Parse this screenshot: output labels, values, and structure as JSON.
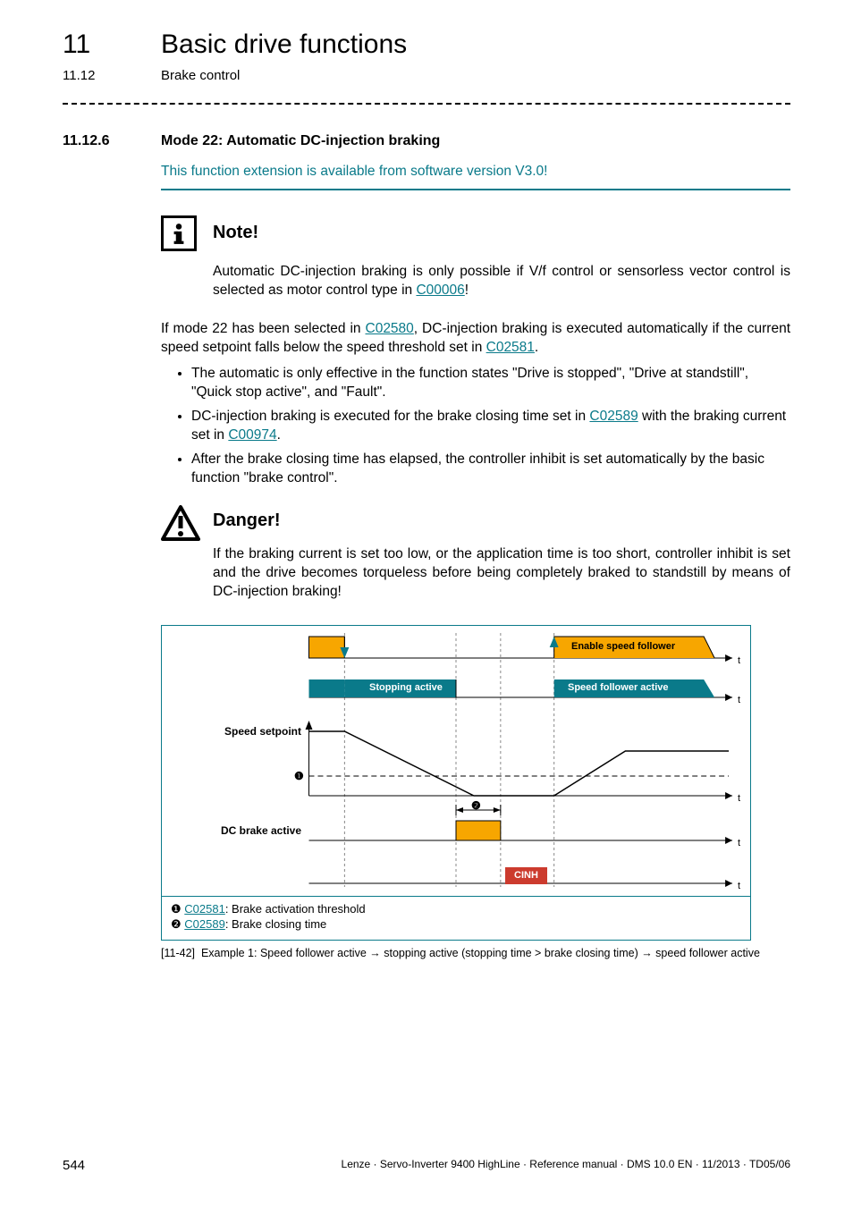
{
  "header": {
    "chapter_num": "11",
    "chapter_title": "Basic drive functions",
    "sub_num": "11.12",
    "sub_title": "Brake control"
  },
  "section": {
    "num": "11.12.6",
    "title": "Mode 22: Automatic DC-injection braking",
    "highlight": "This function extension is available from software version V3.0!"
  },
  "note": {
    "head": "Note!",
    "body_1": "Automatic DC-injection braking is only possible if V/f control or sensorless vector control is selected as motor control type in ",
    "body_link": "C00006",
    "body_2": "!"
  },
  "para": {
    "t1": "If mode 22 has been selected in ",
    "l1": "C02580",
    "t2": ", DC-injection braking is executed automatically if the current speed setpoint falls below the speed threshold set in ",
    "l2": "C02581",
    "t3": "."
  },
  "bullets": {
    "b1": "The automatic is only effective in the function states \"Drive is stopped\", \"Drive at standstill\", \"Quick stop active\", and \"Fault\".",
    "b2_a": "DC-injection braking is executed for the brake closing time set in ",
    "b2_l1": "C02589",
    "b2_b": " with the braking current set in ",
    "b2_l2": "C00974",
    "b2_c": ".",
    "b3": "After the brake closing time has elapsed, the controller inhibit is set automatically by the basic function \"brake control\"."
  },
  "danger": {
    "head": "Danger!",
    "body": "If the braking current is set too low, or the application time is too short, controller inhibit is set and the drive becomes torqueless before being completely braked to standstill by means of DC-injection braking!"
  },
  "chart_data": {
    "type": "timing-diagram",
    "x_axis": "t",
    "tracks": [
      {
        "name": "Enable speed follower",
        "style": "orange-fill",
        "segments": [
          {
            "start": 0,
            "end": 0.3,
            "level": "high"
          },
          {
            "start": 0.3,
            "end": 0.66,
            "level": "low"
          },
          {
            "start": 0.66,
            "end": 1.0,
            "level": "high"
          }
        ],
        "label_at": 0.66,
        "label": "Enable speed follower",
        "arrow_up_at": 0.66
      },
      {
        "name": "Stopping / Speed follower active",
        "style": "blue-fill",
        "segments": [
          {
            "start": 0,
            "end": 0.3,
            "level": "state",
            "text": ""
          },
          {
            "start": 0.3,
            "end": 0.66,
            "level": "state",
            "text": "Stopping active"
          },
          {
            "start": 0.66,
            "end": 1.0,
            "level": "state",
            "text": "Speed follower active"
          }
        ]
      },
      {
        "name": "Speed setpoint",
        "style": "line",
        "points": [
          {
            "x": 0.0,
            "y": 1.0
          },
          {
            "x": 0.3,
            "y": 1.0
          },
          {
            "x": 0.52,
            "y": 0.0
          },
          {
            "x": 0.66,
            "y": 0.0
          },
          {
            "x": 0.8,
            "y": 0.7
          },
          {
            "x": 1.0,
            "y": 0.7
          }
        ],
        "threshold": {
          "marker": "❶",
          "y": 0.22,
          "label_ref": "C02581"
        }
      },
      {
        "name": "DC brake active",
        "style": "orange-fill",
        "segments": [
          {
            "start": 0.47,
            "end": 0.56,
            "level": "high"
          }
        ],
        "duration_marker": {
          "marker": "❷",
          "label_ref": "C02589"
        }
      },
      {
        "name": "CINH",
        "style": "red-fill",
        "segments": [
          {
            "start": 0.56,
            "end": 0.66,
            "level": "high",
            "text": "CINH"
          }
        ]
      }
    ],
    "legend": [
      {
        "marker": "❶",
        "link": "C02581",
        "text": ": Brake activation threshold"
      },
      {
        "marker": "❷",
        "link": "C02589",
        "text": ": Brake closing time"
      }
    ]
  },
  "diagram_labels": {
    "speed_setpoint": "Speed setpoint",
    "dc_brake": "DC brake active",
    "enable_sf": "Enable speed follower",
    "stopping": "Stopping active",
    "sf_active": "Speed follower active",
    "cinh": "CINH",
    "m1": "❶",
    "m2": "❷",
    "t": "t"
  },
  "legend": {
    "row1_m": "❶ ",
    "row1_l": "C02581",
    "row1_t": ": Brake activation threshold",
    "row2_m": "❷ ",
    "row2_l": "C02589",
    "row2_t": ": Brake closing time"
  },
  "caption": {
    "ref": "[11-42]",
    "text": "Example 1: Speed follower active → stopping active (stopping time > brake closing time) → speed follower active"
  },
  "footer": {
    "page": "544",
    "text": "Lenze · Servo-Inverter 9400 HighLine · Reference manual · DMS 10.0 EN · 11/2013 · TD05/06"
  }
}
